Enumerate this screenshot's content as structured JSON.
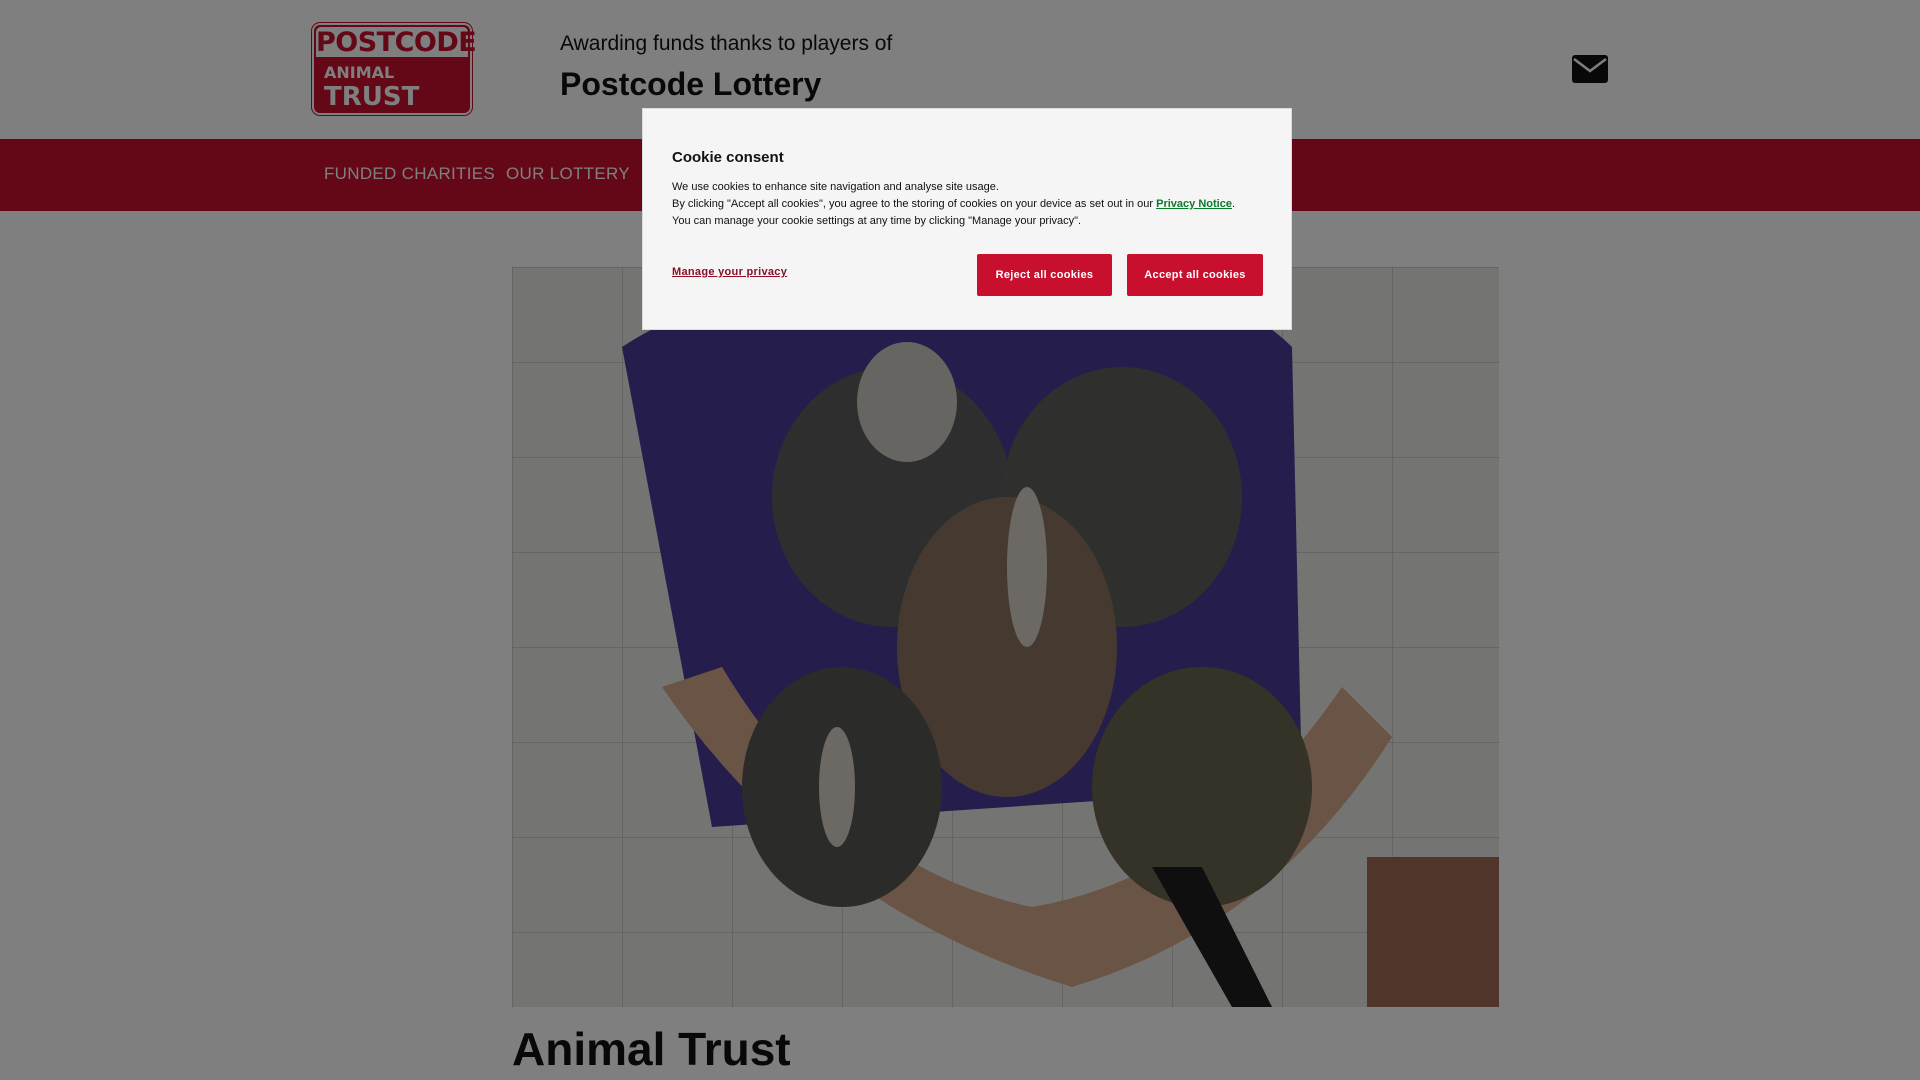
{
  "header": {
    "logo": {
      "line1": "POSTCODE",
      "line2": "ANIMAL",
      "line3": "TRUST"
    },
    "tagline": "Awarding funds thanks to players of",
    "lottery_name": "Postcode Lottery",
    "icon": "envelope-icon"
  },
  "nav": {
    "items": [
      {
        "label": "FUNDED CHARITIES"
      },
      {
        "label": "OUR LOTTERY"
      }
    ]
  },
  "main": {
    "hero_image": "puppies-held-in-arms",
    "title": "Animal Trust"
  },
  "cookie_modal": {
    "title": "Cookie consent",
    "line1": "We use cookies to enhance site navigation and analyse site usage.",
    "line2_prefix": "By clicking \"Accept all cookies\", you agree to the storing of cookies on your device as set out in our ",
    "privacy_link": "Privacy Notice",
    "line2_suffix": ".",
    "line3": "You can manage your cookie settings at any time by clicking \"Manage your privacy\".",
    "manage_label": "Manage your privacy",
    "reject_label": "Reject all cookies",
    "accept_label": "Accept all cookies"
  },
  "colors": {
    "brand_red": "#c8102e",
    "link_green": "#0a7a2a"
  }
}
